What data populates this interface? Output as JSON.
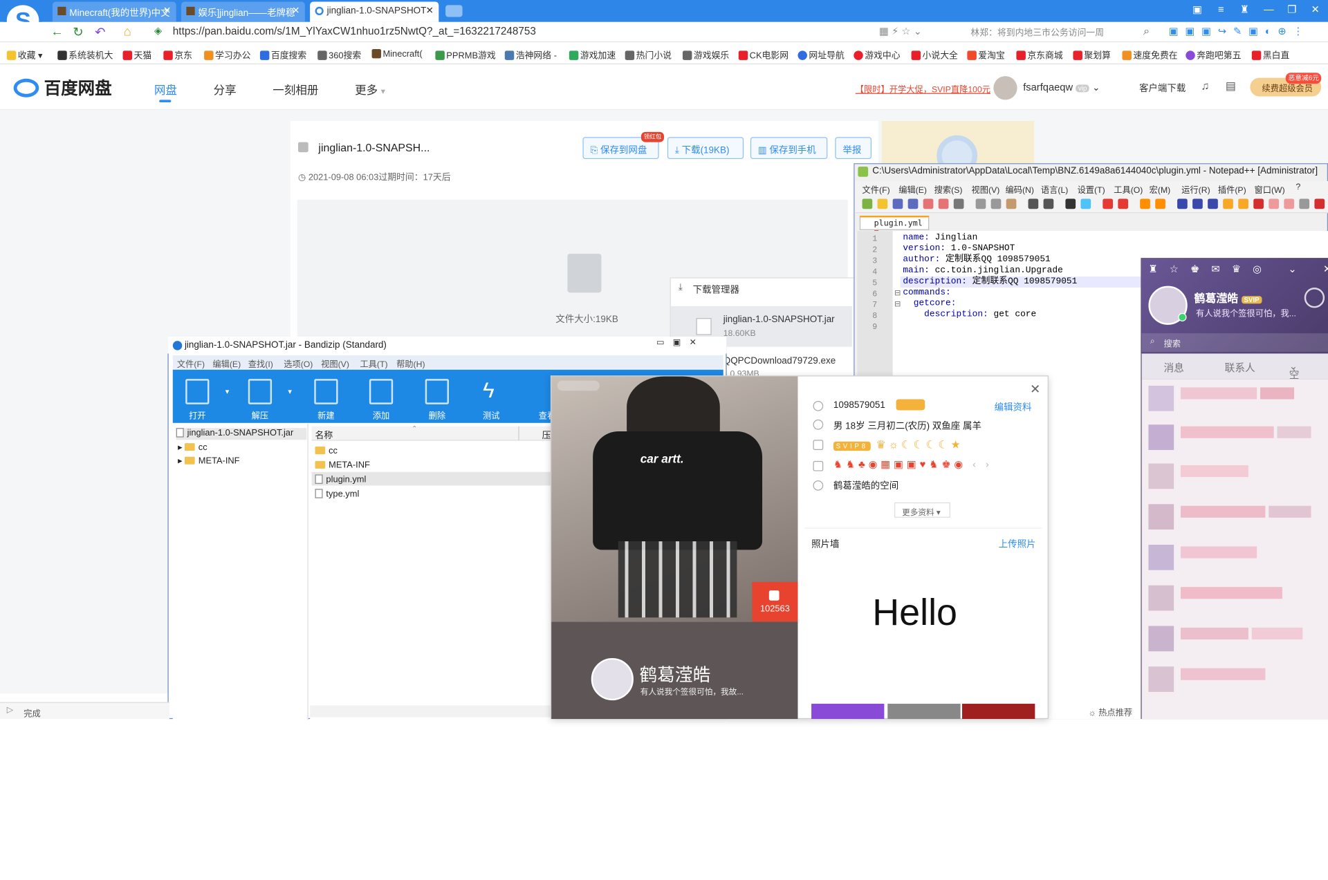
{
  "browser": {
    "tabs": [
      {
        "label": "Minecraft(我的世界)中文",
        "active": false
      },
      {
        "label": "娱乐]jinglian——老牌稳",
        "active": false
      },
      {
        "label": "jinglian-1.0-SNAPSHOT",
        "active": true
      }
    ],
    "url": "https://pan.baidu.com/s/1M_YlYaxCW1nhuo1rz5NwtQ?_at_=1632217248753",
    "addr_hint": "林郑：将到内地三市公务访问一周",
    "bookmarks": [
      "收藏",
      "系统装机大",
      "天猫",
      "京东",
      "学习办公",
      "百度搜索",
      "360搜索",
      "Minecraft(",
      "PPRMB游戏",
      "浩神网络 -",
      "游戏加速",
      "热门小说",
      "游戏娱乐",
      "CK电影网",
      "网址导航",
      "游戏中心",
      "小说大全",
      "爱淘宝",
      "京东商城",
      "聚划算",
      "速度免费在",
      "奔跑吧第五",
      "黑白直"
    ],
    "status": "完成",
    "hot": "热点推荐"
  },
  "baidu": {
    "brand": "百度网盘",
    "nav": [
      "网盘",
      "分享",
      "一刻相册",
      "更多"
    ],
    "promo": "【限时】开学大促，SVIP直降100元",
    "username": "fsarfqaeqw",
    "client_download": "客户端下载",
    "vip_button": "续费超级会员",
    "vip_badge": "恶意减6元",
    "file_title": "jinglian-1.0-SNAPSH...",
    "save_btn": "保存到网盘",
    "red_tag": "领红包",
    "download_btn": "下载(19KB)",
    "save_phone_btn": "保存到手机",
    "report_btn": "举报",
    "expiry": "2021-09-08 06:03过期时间：17天后",
    "file_size": "文件大小:19KB"
  },
  "download_manager": {
    "title": "下载管理器",
    "items": [
      {
        "name": "jinglian-1.0-SNAPSHOT.jar",
        "size": "18.60KB"
      },
      {
        "name": "QQPCDownload79729.exe",
        "size": "0.93MB"
      }
    ]
  },
  "bandizip": {
    "title": "jinglian-1.0-SNAPSHOT.jar - Bandizip (Standard)",
    "menu": [
      "文件(F)",
      "编辑(E)",
      "查找(I)",
      "选项(O)",
      "视图(V)",
      "工具(T)",
      "帮助(H)"
    ],
    "tools": [
      "打开",
      "解压",
      "新建",
      "添加",
      "删除",
      "测试",
      "查看"
    ],
    "tree_root": "jinglian-1.0-SNAPSHOT.jar",
    "tree": [
      "cc",
      "META-INF"
    ],
    "col_name": "名称",
    "col_size": "压",
    "files": [
      "cc",
      "META-INF",
      "plugin.yml",
      "type.yml"
    ]
  },
  "notepad": {
    "title": "C:\\Users\\Administrator\\AppData\\Local\\Temp\\BNZ.6149a8a6144040c\\plugin.yml - Notepad++ [Administrator]",
    "menu": [
      "文件(F)",
      "编辑(E)",
      "搜索(S)",
      "视图(V)",
      "编码(N)",
      "语言(L)",
      "设置(T)",
      "工具(O)",
      "宏(M)",
      "运行(R)",
      "插件(P)",
      "窗口(W)",
      "?"
    ],
    "tab": "plugin.yml",
    "lines": [
      {
        "k": "name:",
        "v": " Jinglian"
      },
      {
        "k": "version:",
        "v": " 1.0-SNAPSHOT"
      },
      {
        "k": "author:",
        "v": " 定制联系QQ 1098579051"
      },
      {
        "k": "main:",
        "v": " cc.toin.jinglian.Upgrade"
      },
      {
        "k": "description:",
        "v": " 定制联系QQ 1098579051"
      },
      {
        "k": "commands:",
        "v": ""
      },
      {
        "k": "  getcore:",
        "v": ""
      },
      {
        "k": "    description:",
        "v": " get core"
      },
      {
        "k": "",
        "v": ""
      }
    ],
    "line_numbers": [
      "1",
      "2",
      "3",
      "4",
      "5",
      "6",
      "7",
      "8",
      "9"
    ]
  },
  "qq_panel": {
    "name": "鹤葛滢皓",
    "svip": "SVIP",
    "signature": "有人说我个签很可怕，我...",
    "search": "搜索",
    "tabs": [
      "消息",
      "联系人",
      "空间"
    ]
  },
  "qq_profile": {
    "photo_text": "car artt.",
    "likes": "102563",
    "name": "鹤葛滢皓",
    "sign": "有人说我个签很可怕，我故...",
    "qq_number": "1098579051",
    "edit_link": "编辑资料",
    "info": "男    18岁    三月初二(农历)    双鱼座    属羊",
    "space": "鹤葛滢皓的空间",
    "more": "更多资料",
    "photo_wall": "照片墙",
    "upload": "上传照片",
    "hello": "Hello"
  }
}
